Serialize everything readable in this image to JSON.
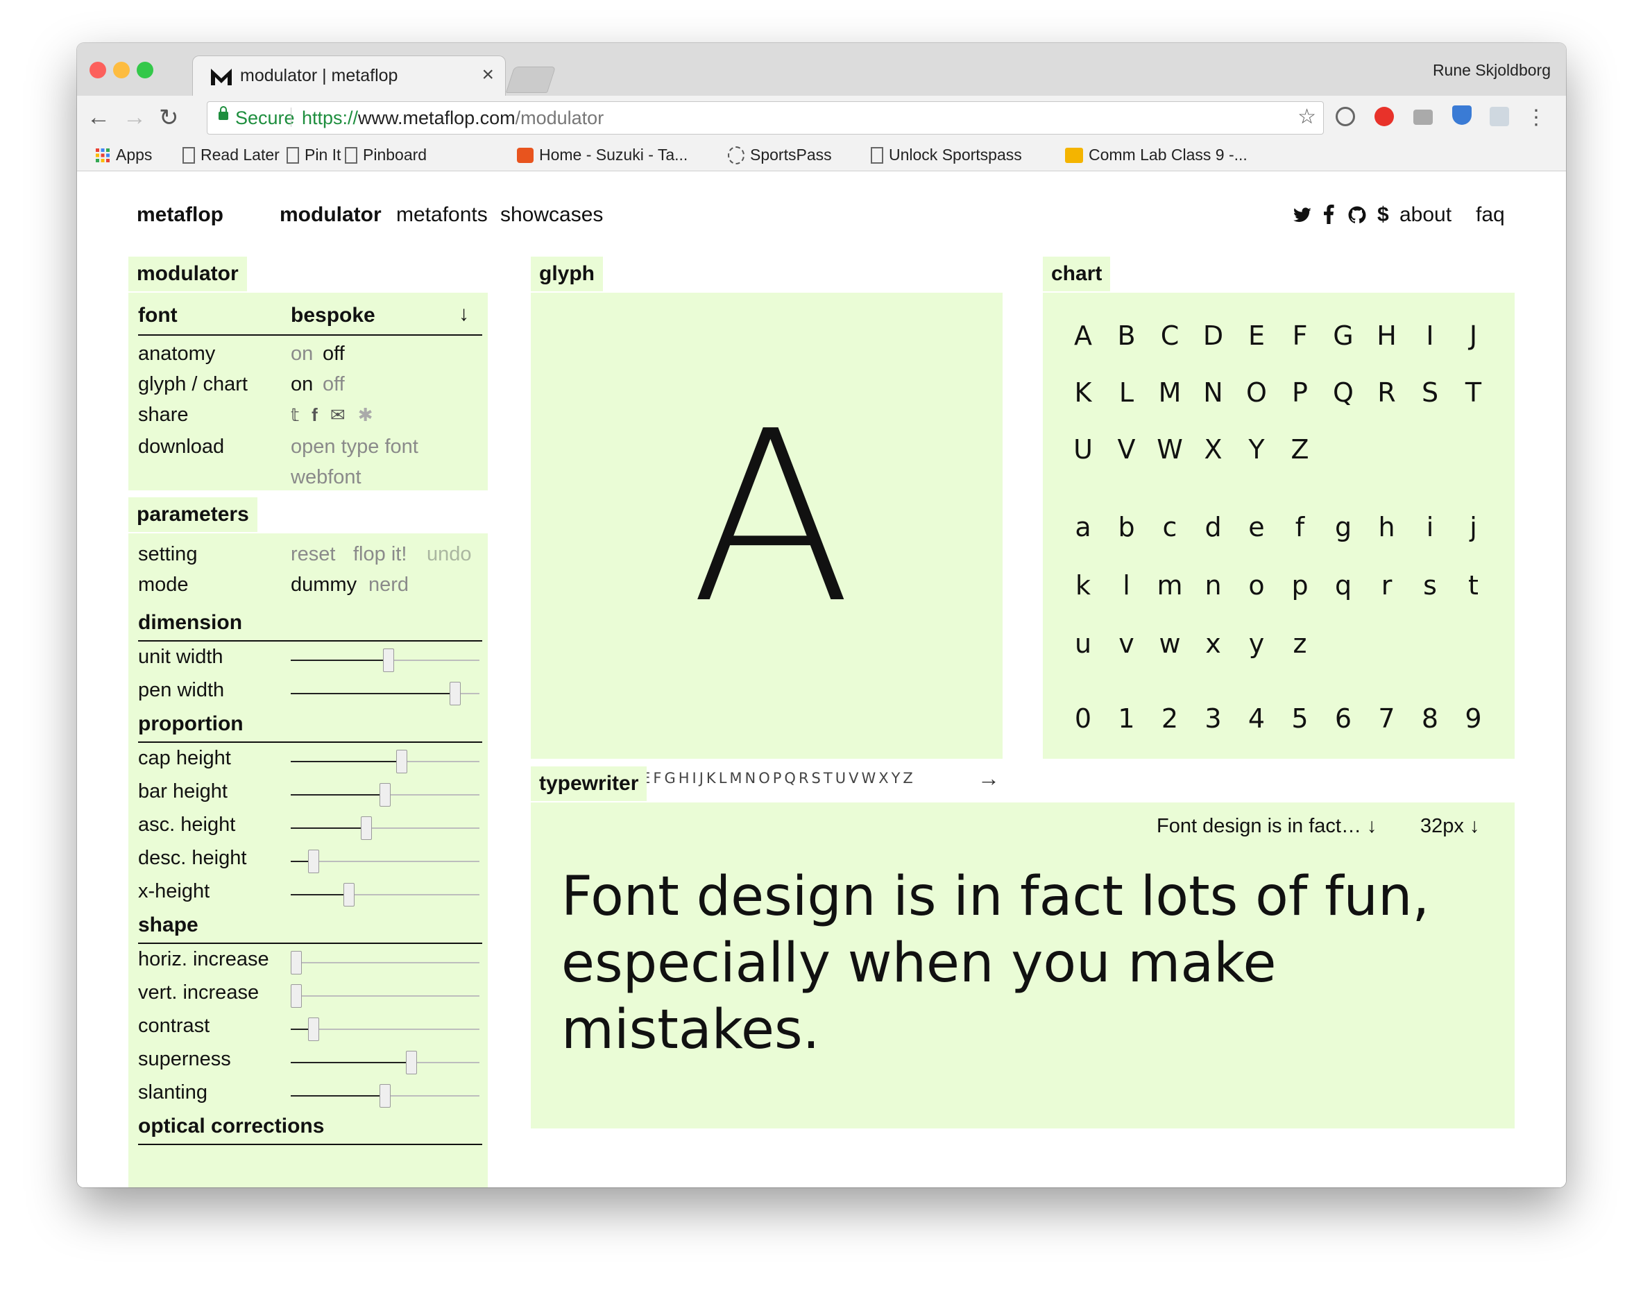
{
  "browser": {
    "tab_title": "modulator | metaflop",
    "tab_close": "×",
    "profile_name": "Rune Skjoldborg",
    "secure_label": "Secure",
    "url_scheme": "https://",
    "url_host": "www.metaflop.com",
    "url_path": "/modulator",
    "back": "←",
    "forward": "→",
    "reload": "↻",
    "star": "☆",
    "menu": "⋮",
    "bookmarks": [
      "Apps",
      "Read Later",
      "Pin It",
      "Pinboard",
      "Home - Suzuki - Ta...",
      "SportsPass",
      "Unlock Sportspass",
      "Comm Lab Class 9 -..."
    ]
  },
  "site_nav": {
    "brand": "metaflop",
    "links": [
      "modulator",
      "metafonts",
      "showcases"
    ],
    "right_links": [
      "about",
      "faq"
    ],
    "icons": [
      "twitter-icon",
      "facebook-icon",
      "github-icon",
      "dollar-icon"
    ],
    "dollar": "$"
  },
  "modulator": {
    "title": "modulator",
    "font_label": "font",
    "font_value": "bespoke",
    "font_arrow": "↓",
    "anatomy_label": "anatomy",
    "anatomy_on": "on",
    "anatomy_off": "off",
    "glyph_chart_label": "glyph / chart",
    "glyph_chart_on": "on",
    "glyph_chart_off": "off",
    "share_label": "share",
    "download_label": "download",
    "download_otf": "open type font",
    "download_web": "webfont"
  },
  "parameters": {
    "title": "parameters",
    "setting_label": "setting",
    "reset": "reset",
    "flop": "flop it!",
    "undo": "undo",
    "mode_label": "mode",
    "dummy": "dummy",
    "nerd": "nerd",
    "sections": [
      {
        "title": "dimension",
        "sliders": [
          {
            "label": "unit width",
            "value": 0.52
          },
          {
            "label": "pen width",
            "value": 0.87
          }
        ]
      },
      {
        "title": "proportion",
        "sliders": [
          {
            "label": "cap height",
            "value": 0.59
          },
          {
            "label": "bar height",
            "value": 0.5
          },
          {
            "label": "asc. height",
            "value": 0.4
          },
          {
            "label": "desc. height",
            "value": 0.12
          },
          {
            "label": "x-height",
            "value": 0.31
          }
        ]
      },
      {
        "title": "shape",
        "sliders": [
          {
            "label": "horiz. increase",
            "value": 0.03
          },
          {
            "label": "vert. increase",
            "value": 0.03
          },
          {
            "label": "contrast",
            "value": 0.12
          },
          {
            "label": "superness",
            "value": 0.64
          },
          {
            "label": "slanting",
            "value": 0.5
          }
        ]
      },
      {
        "title": "optical corrections",
        "sliders": []
      }
    ]
  },
  "glyph": {
    "title": "glyph",
    "letter": "A",
    "strip_current": "A",
    "strip_rest": "BCDEFGHIJKLMNOPQRSTUVWXYZ",
    "prev": "←",
    "next": "→"
  },
  "chart": {
    "title": "chart",
    "rows": [
      [
        "A",
        "B",
        "C",
        "D",
        "E",
        "F",
        "G",
        "H",
        "I",
        "J"
      ],
      [
        "K",
        "L",
        "M",
        "N",
        "O",
        "P",
        "Q",
        "R",
        "S",
        "T"
      ],
      [
        "U",
        "V",
        "W",
        "X",
        "Y",
        "Z"
      ],
      [
        "a",
        "b",
        "c",
        "d",
        "e",
        "f",
        "g",
        "h",
        "i",
        "j"
      ],
      [
        "k",
        "l",
        "m",
        "n",
        "o",
        "p",
        "q",
        "r",
        "s",
        "t"
      ],
      [
        "u",
        "v",
        "w",
        "x",
        "y",
        "z"
      ],
      [
        "0",
        "1",
        "2",
        "3",
        "4",
        "5",
        "6",
        "7",
        "8",
        "9"
      ]
    ]
  },
  "typewriter": {
    "title": "typewriter",
    "sample_select": "Font design is in fact… ↓",
    "size_select": "32px ↓",
    "text": "Font design is in fact lots of fun, especially when you make mistakes."
  },
  "colors": {
    "panel_green": "#eafcd6",
    "secure_green": "#1e8e3e"
  }
}
